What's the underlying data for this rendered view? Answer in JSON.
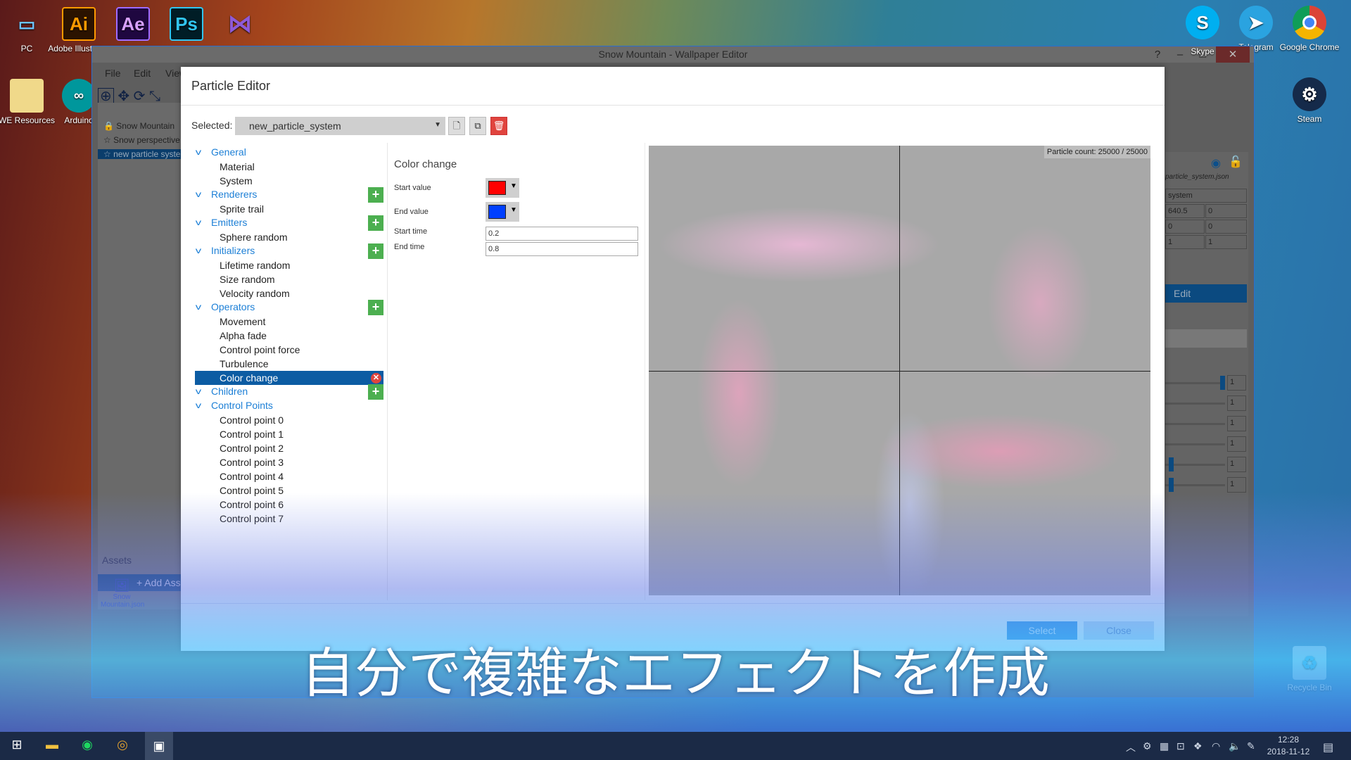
{
  "desktop": {
    "icons_left": [
      {
        "label": "PC",
        "icon": "monitor-icon"
      },
      {
        "label": "Adobe Illustrator",
        "icon": "Ai"
      },
      {
        "label": "Ae",
        "icon": "Ae"
      },
      {
        "label": "Ps",
        "icon": "Ps"
      },
      {
        "label": "",
        "icon": "visual-studio-icon"
      },
      {
        "label": "WE Resources",
        "icon": "folder-icon"
      },
      {
        "label": "Arduino",
        "icon": "arduino-icon"
      }
    ],
    "icons_right": [
      {
        "label": "Skype",
        "icon": "S"
      },
      {
        "label": "Telegram",
        "icon": "telegram-icon"
      },
      {
        "label": "Google Chrome",
        "icon": "chrome-icon"
      },
      {
        "label": "Steam",
        "icon": "steam-icon"
      },
      {
        "label": "Recycle Bin",
        "icon": "recycle-bin-icon"
      }
    ]
  },
  "editor": {
    "title": "Snow Mountain - Wallpaper Editor",
    "window_buttons": {
      "help": "?",
      "minimize": "–",
      "maximize": "□",
      "close": "✕"
    },
    "menu": [
      "File",
      "Edit",
      "View"
    ],
    "scene_tree": [
      {
        "label": "Snow Mountain",
        "icon": "lock-icon"
      },
      {
        "label": "Snow perspective",
        "icon": "star-icon"
      },
      {
        "label": "new particle system",
        "icon": "star-icon"
      }
    ],
    "add_assets": "+ Add Assets",
    "assets_tab": "Assets",
    "asset_item": "Snow Mountain.json",
    "right_panel": {
      "file": "particle_system.json",
      "name": "system",
      "cells": [
        [
          "640.5",
          "0"
        ],
        [
          "0",
          "0"
        ],
        [
          "1",
          "1"
        ]
      ],
      "edit_button": "Edit",
      "slider_values": [
        "1",
        "1",
        "1",
        "1",
        "1",
        "1"
      ]
    }
  },
  "dialog": {
    "title": "Particle Editor",
    "selected_label": "Selected:",
    "selected_value": "new_particle_system",
    "tree": [
      {
        "type": "h",
        "label": "General",
        "add": false
      },
      {
        "type": "i",
        "label": "Material"
      },
      {
        "type": "i",
        "label": "System"
      },
      {
        "type": "h",
        "label": "Renderers",
        "add": true
      },
      {
        "type": "i",
        "label": "Sprite trail"
      },
      {
        "type": "h",
        "label": "Emitters",
        "add": true
      },
      {
        "type": "i",
        "label": "Sphere random"
      },
      {
        "type": "h",
        "label": "Initializers",
        "add": true
      },
      {
        "type": "i",
        "label": "Lifetime random"
      },
      {
        "type": "i",
        "label": "Size random"
      },
      {
        "type": "i",
        "label": "Velocity random"
      },
      {
        "type": "h",
        "label": "Operators",
        "add": true
      },
      {
        "type": "i",
        "label": "Movement"
      },
      {
        "type": "i",
        "label": "Alpha fade"
      },
      {
        "type": "i",
        "label": "Control point force"
      },
      {
        "type": "i",
        "label": "Turbulence"
      },
      {
        "type": "i",
        "label": "Color change",
        "selected": true
      },
      {
        "type": "h",
        "label": "Children",
        "add": true
      },
      {
        "type": "h",
        "label": "Control Points",
        "add": false
      },
      {
        "type": "i",
        "label": "Control point 0"
      },
      {
        "type": "i",
        "label": "Control point 1"
      },
      {
        "type": "i",
        "label": "Control point 2"
      },
      {
        "type": "i",
        "label": "Control point 3"
      },
      {
        "type": "i",
        "label": "Control point 4"
      },
      {
        "type": "i",
        "label": "Control point 5"
      },
      {
        "type": "i",
        "label": "Control point 6"
      },
      {
        "type": "i",
        "label": "Control point 7"
      }
    ],
    "props": {
      "title": "Color change",
      "start_value_label": "Start value",
      "start_color": "#ff0000",
      "end_value_label": "End value",
      "end_color": "#0040ff",
      "start_time_label": "Start time",
      "start_time": "0.2",
      "end_time_label": "End time",
      "end_time": "0.8"
    },
    "preview": {
      "particle_count": "Particle count: 25000 / 25000"
    },
    "select_button": "Select",
    "close_button": "Close"
  },
  "caption": "自分で複雑なエフェクトを作成",
  "taskbar": {
    "time": "12:28",
    "date": "2018-11-12"
  },
  "colors": {
    "accent": "#0c5ca3",
    "add": "#4caf50",
    "delete": "#e0443e",
    "select_button": "#1a7fe0"
  }
}
